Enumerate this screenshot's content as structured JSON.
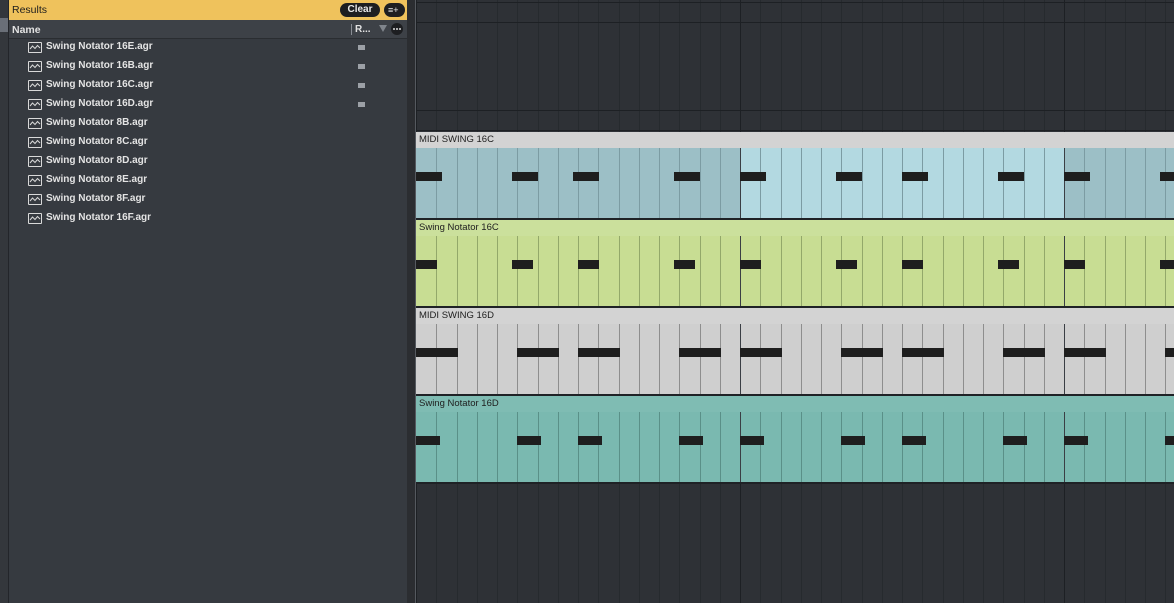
{
  "browser": {
    "results_label": "Results",
    "clear_label": "Clear",
    "add_filter_label": "≡+",
    "column_name": "Name",
    "column_rating": "R...",
    "files": [
      {
        "label": "Swing Notator 16E.agr",
        "marked": true
      },
      {
        "label": "Swing Notator 16B.agr",
        "marked": true
      },
      {
        "label": "Swing Notator 16C.agr",
        "marked": true
      },
      {
        "label": "Swing Notator 16D.agr",
        "marked": true
      },
      {
        "label": "Swing Notator 8B.agr",
        "marked": false
      },
      {
        "label": "Swing Notator 8C.agr",
        "marked": false
      },
      {
        "label": "Swing Notator 8D.agr",
        "marked": false
      },
      {
        "label": "Swing Notator 8E.agr",
        "marked": false
      },
      {
        "label": "Swing Notator 8F.agr",
        "marked": false
      },
      {
        "label": "Swing Notator 16F.agr",
        "marked": false
      }
    ],
    "file_icon": "waveform-file-icon"
  },
  "arrangement": {
    "clips": [
      {
        "name": "MIDI SWING 16C",
        "header_color": "#d3d3d3",
        "body_colors": [
          "#9cbfc6",
          "#b3d9e1",
          "#9cbfc6"
        ],
        "grid_color": "#7c9ca3",
        "notes": [
          {
            "step": 0,
            "len": 1.0
          },
          {
            "step": 4.75,
            "len": 1.0
          },
          {
            "step": 7.75,
            "len": 1.0
          },
          {
            "step": 12.75,
            "len": 1.0
          },
          {
            "step": 16,
            "len": 1.0
          },
          {
            "step": 20.75,
            "len": 1.0
          },
          {
            "step": 24,
            "len": 1.0
          },
          {
            "step": 28.75,
            "len": 1.0
          },
          {
            "step": 32,
            "len": 1.0
          },
          {
            "step": 36.75,
            "len": 1.0
          }
        ]
      },
      {
        "name": "Swing Notator 16C",
        "header_color": "#cbe09c",
        "body_colors": [
          "#c8dd93",
          "#c8dd93",
          "#c8dd93"
        ],
        "grid_color": "#93a86a",
        "notes": [
          {
            "step": 0,
            "len": 0.8
          },
          {
            "step": 4.75,
            "len": 0.8
          },
          {
            "step": 8,
            "len": 0.8
          },
          {
            "step": 12.75,
            "len": 0.8
          },
          {
            "step": 16,
            "len": 0.8
          },
          {
            "step": 20.75,
            "len": 0.8
          },
          {
            "step": 24,
            "len": 0.8
          },
          {
            "step": 28.75,
            "len": 0.8
          },
          {
            "step": 32,
            "len": 0.8
          },
          {
            "step": 36.75,
            "len": 0.8
          }
        ]
      },
      {
        "name": "MIDI SWING 16D",
        "header_color": "#d3d3d3",
        "body_colors": [
          "#cfcfcf",
          "#cfcfcf",
          "#cfcfcf"
        ],
        "grid_color": "#8e8e8e",
        "notes": [
          {
            "step": 0,
            "len": 1.6
          },
          {
            "step": 5,
            "len": 1.6
          },
          {
            "step": 8,
            "len": 1.6
          },
          {
            "step": 13,
            "len": 1.6
          },
          {
            "step": 16,
            "len": 1.6
          },
          {
            "step": 21,
            "len": 1.6
          },
          {
            "step": 24,
            "len": 1.6
          },
          {
            "step": 29,
            "len": 1.6
          },
          {
            "step": 32,
            "len": 1.6
          },
          {
            "step": 37,
            "len": 1.6
          }
        ]
      },
      {
        "name": "Swing Notator 16D",
        "header_color": "#7fbcb3",
        "body_colors": [
          "#7ab9b0",
          "#7ab9b0",
          "#7ab9b0"
        ],
        "grid_color": "#5a9088",
        "notes": [
          {
            "step": 0,
            "len": 0.9
          },
          {
            "step": 5,
            "len": 0.9
          },
          {
            "step": 8,
            "len": 0.9
          },
          {
            "step": 13,
            "len": 0.9
          },
          {
            "step": 16,
            "len": 0.9
          },
          {
            "step": 21,
            "len": 0.9
          },
          {
            "step": 24,
            "len": 0.9
          },
          {
            "step": 29,
            "len": 0.9
          },
          {
            "step": 32,
            "len": 0.9
          },
          {
            "step": 37,
            "len": 0.9
          }
        ]
      }
    ]
  }
}
